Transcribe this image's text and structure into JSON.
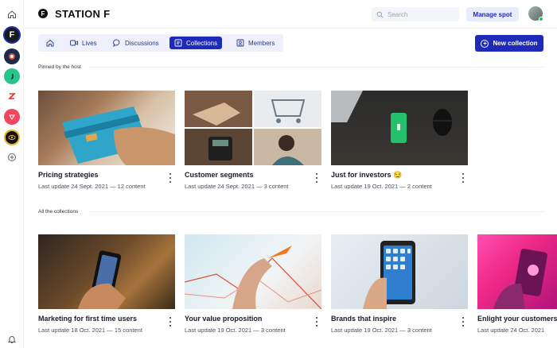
{
  "header": {
    "brand_letter": "F",
    "title": "STATION F",
    "search_placeholder": "Search",
    "manage_label": "Manage spot"
  },
  "rail": {
    "sf_letter": "F"
  },
  "tabs": [
    {
      "label": ""
    },
    {
      "label": "Lives"
    },
    {
      "label": "Discussions"
    },
    {
      "label": "Collections"
    },
    {
      "label": "Members"
    }
  ],
  "active_tab": "Collections",
  "new_collection_label": "New collection",
  "pinned_label": "Pinned by the host",
  "all_label": "All the collections",
  "pinned": [
    {
      "title": "Pricing strategies",
      "meta": "Last update 24 Sept. 2021 — 12 content"
    },
    {
      "title": "Customer segments",
      "meta": "Last update 24 Sept. 2021 — 3 content"
    },
    {
      "title": "Just for investors 😏",
      "meta": "Last update 19 Oct. 2021 — 2 content"
    }
  ],
  "collections": [
    {
      "title": "Marketing for first time users",
      "meta": "Last update 18 Oct. 2021 — 15 content"
    },
    {
      "title": "Your value proposition",
      "meta": "Last update 19 Oct. 2021 — 3 content"
    },
    {
      "title": "Brands that inspire",
      "meta": "Last update 19 Oct. 2021 — 3 content"
    },
    {
      "title": "Enlight your customers",
      "meta": "Last update 24 Oct. 2021"
    }
  ],
  "colors": {
    "accent": "#1d2bb8",
    "tab_bg": "#eef1fb",
    "online": "#22c55e"
  }
}
